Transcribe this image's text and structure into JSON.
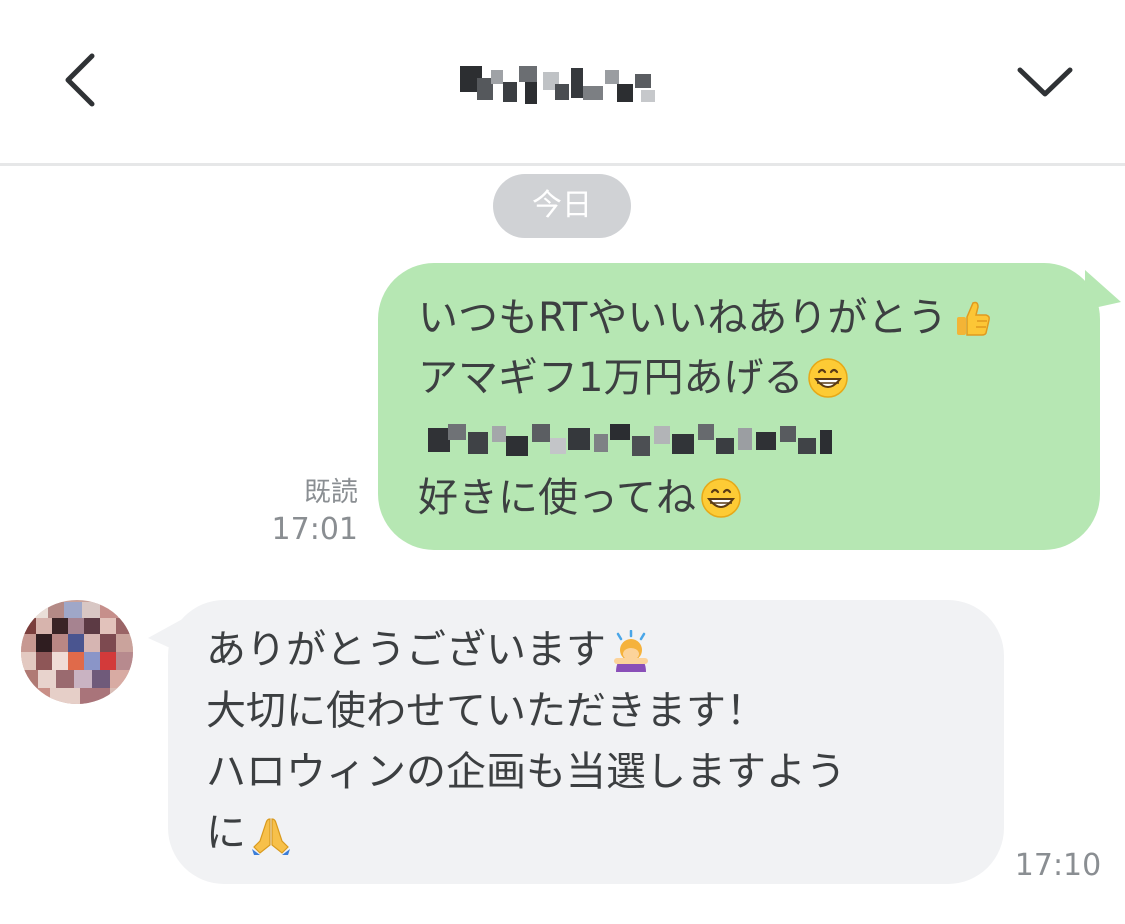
{
  "header": {
    "back_icon": "chevron-left-icon",
    "menu_icon": "chevron-down-icon",
    "title_blurred": true
  },
  "date_separator": "今日",
  "messages": [
    {
      "direction": "outgoing",
      "lines": [
        "いつもRTやいいねありがとう",
        "アマギフ1万円あげる",
        "",
        "好きに使ってね"
      ],
      "emoji": [
        "thumbs-up-icon",
        "grinning-face-icon",
        "grinning-face-icon"
      ],
      "read_label": "既読",
      "time": "17:01"
    },
    {
      "direction": "incoming",
      "lines": [
        "ありがとうございます",
        "大切に使わせていただきます！",
        "ハロウィンの企画も当選しますよう",
        "に"
      ],
      "emoji": [
        "person-bowing-icon",
        "folded-hands-icon"
      ],
      "time": "17:10"
    }
  ],
  "colors": {
    "outgoing_bubble": "#b6e7b3",
    "incoming_bubble": "#f1f2f4",
    "date_pill": "#d0d2d5",
    "meta_text": "#8a8e92",
    "header_divider": "#e6e7e8"
  }
}
